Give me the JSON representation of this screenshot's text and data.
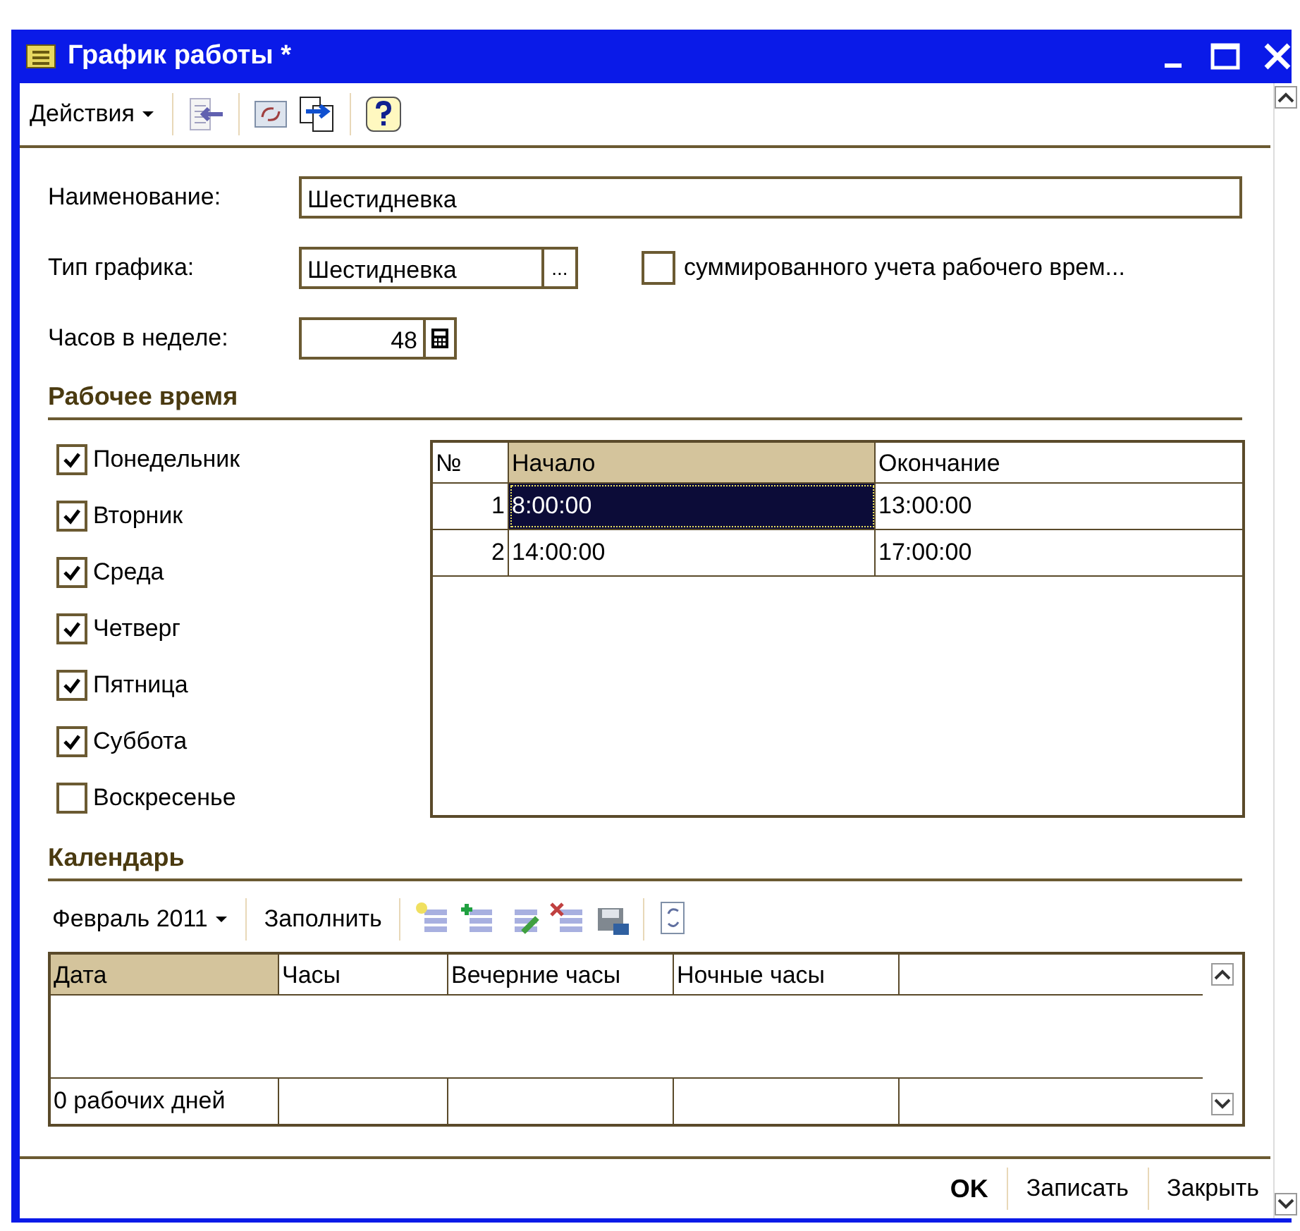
{
  "window": {
    "title": "График работы *"
  },
  "toolbar": {
    "actions_menu": "Действия"
  },
  "form": {
    "name": {
      "label": "Наименование:",
      "value": "Шестидневка"
    },
    "schedule_type": {
      "label": "Тип графика:",
      "value": "Шестидневка",
      "button": "..."
    },
    "summarized": {
      "label": "суммированного учета рабочего врем...",
      "checked": false
    },
    "hours_per_week": {
      "label": "Часов в неделе:",
      "value": "48"
    }
  },
  "work_time": {
    "title": "Рабочее время",
    "days": [
      {
        "label": "Понедельник",
        "checked": true
      },
      {
        "label": "Вторник",
        "checked": true
      },
      {
        "label": "Среда",
        "checked": true
      },
      {
        "label": "Четверг",
        "checked": true
      },
      {
        "label": "Пятница",
        "checked": true
      },
      {
        "label": "Суббота",
        "checked": true
      },
      {
        "label": "Воскресенье",
        "checked": false
      }
    ],
    "table": {
      "columns": [
        {
          "label": "№",
          "selected": false
        },
        {
          "label": "Начало",
          "selected": true
        },
        {
          "label": "Окончание",
          "selected": false
        }
      ],
      "rows": [
        {
          "number": "1",
          "start": "8:00:00",
          "end": "13:00:00",
          "selected": true
        },
        {
          "number": "2",
          "start": "14:00:00",
          "end": "17:00:00",
          "selected": false
        }
      ]
    }
  },
  "calendar": {
    "title": "Календарь",
    "period": "Февраль 2011",
    "fill_button": "Заполнить",
    "columns": [
      {
        "label": "Дата",
        "selected": true
      },
      {
        "label": "Часы",
        "selected": false
      },
      {
        "label": "Вечерние часы",
        "selected": false
      },
      {
        "label": "Ночные часы",
        "selected": false
      }
    ],
    "footer": "0 рабочих дней"
  },
  "buttons": [
    {
      "label": "OK",
      "default": true
    },
    {
      "label": "Записать",
      "default": false
    },
    {
      "label": "Закрыть",
      "default": false
    }
  ]
}
